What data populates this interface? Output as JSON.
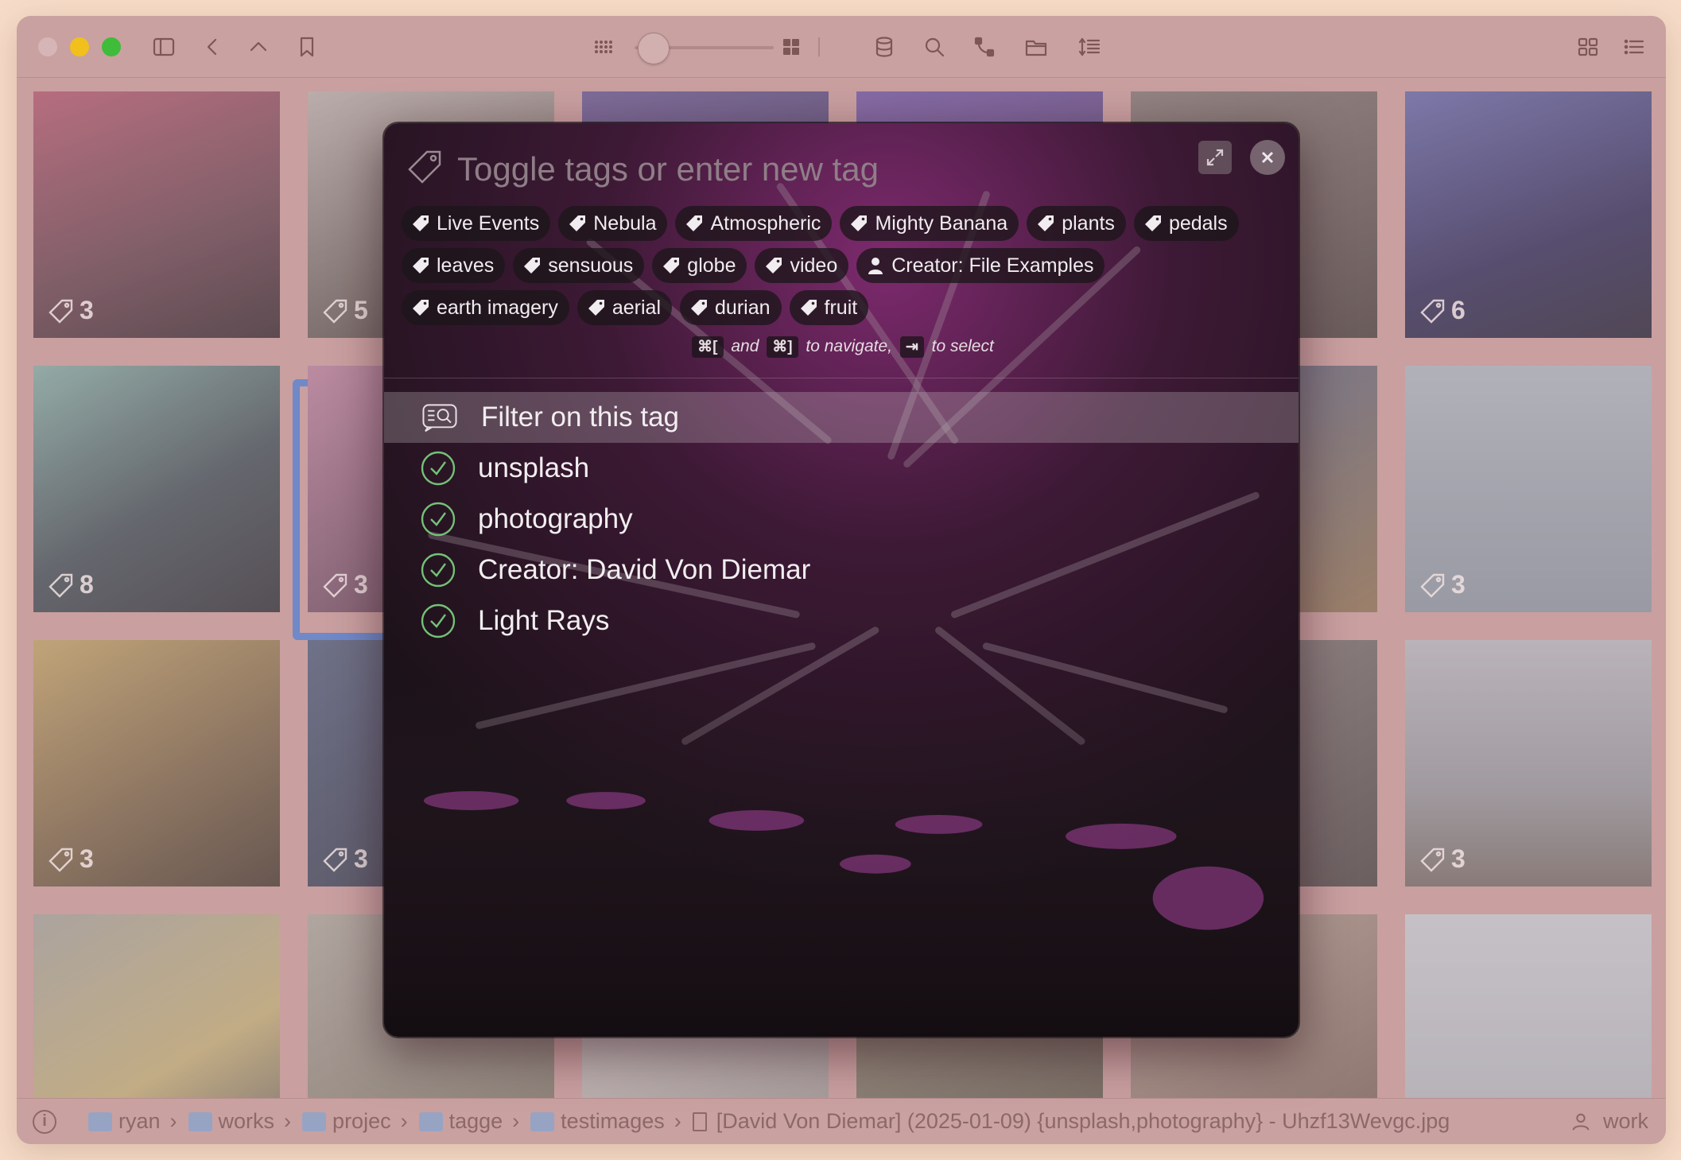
{
  "toolbar": {
    "icons": [
      "sidebar-icon",
      "back-icon",
      "up-icon",
      "bookmark-icon",
      "small-grid-icon",
      "zoom-slider",
      "large-grid-icon",
      "database-icon",
      "search-icon",
      "graph-icon",
      "folder-icon",
      "sort-icon",
      "grid-view-icon",
      "list-view-icon"
    ],
    "thumbnail_zoom": 0.15
  },
  "grid": {
    "tag_counts": [
      "3",
      "5",
      "",
      "",
      "",
      "6",
      "8",
      "3",
      "",
      "",
      "",
      "3",
      "3",
      "3",
      "",
      "",
      "",
      "3",
      "",
      "",
      "",
      "",
      "",
      ""
    ]
  },
  "dialog": {
    "search_placeholder": "Toggle tags or enter new tag",
    "chip_rows": [
      [
        {
          "label": "Live Events",
          "icon": "tag"
        },
        {
          "label": "Nebula",
          "icon": "tag"
        },
        {
          "label": "Atmospheric",
          "icon": "tag"
        },
        {
          "label": "Mighty Banana",
          "icon": "tag"
        },
        {
          "label": "plants",
          "icon": "tag"
        },
        {
          "label": "pedals",
          "icon": "tag"
        }
      ],
      [
        {
          "label": "leaves",
          "icon": "tag"
        },
        {
          "label": "sensuous",
          "icon": "tag"
        },
        {
          "label": "globe",
          "icon": "tag"
        },
        {
          "label": "video",
          "icon": "tag"
        },
        {
          "label": "Creator: File Examples",
          "icon": "person"
        }
      ],
      [
        {
          "label": "earth imagery",
          "icon": "tag"
        },
        {
          "label": "aerial",
          "icon": "tag"
        },
        {
          "label": "durian",
          "icon": "tag"
        },
        {
          "label": "fruit",
          "icon": "tag"
        }
      ]
    ],
    "hint": {
      "key1": "⌘[",
      "and": "and",
      "key2": "⌘]",
      "navigate": "to navigate,",
      "key3": "⇥",
      "select": "to select"
    },
    "list": [
      {
        "label": "Filter on this tag",
        "icon": "filter",
        "active": true
      },
      {
        "label": "unsplash",
        "icon": "check",
        "active": false
      },
      {
        "label": "photography",
        "icon": "check",
        "active": false
      },
      {
        "label": "Creator: David Von Diemar",
        "icon": "check",
        "active": false
      },
      {
        "label": "Light Rays",
        "icon": "check",
        "active": false
      }
    ]
  },
  "statusbar": {
    "crumbs": [
      "ryan",
      "works",
      "projec",
      "tagge",
      "testimages"
    ],
    "file": "[David Von Diemar] (2025-01-09) {unsplash,photography} - Uhzf13Wevgc.jpg",
    "workspace": "work"
  },
  "colors": {
    "check": "#74c177",
    "selection": "#6f89c9",
    "traffic_min": "#f2c01c",
    "traffic_max": "#3fbc3a"
  }
}
